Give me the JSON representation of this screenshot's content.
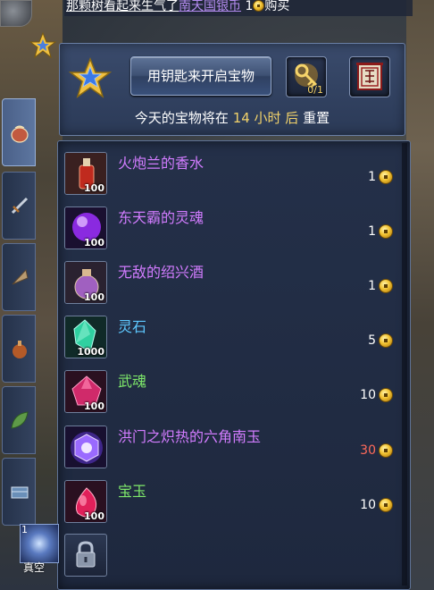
{
  "top_message": {
    "prefix": "那颗树看起来生气了",
    "link": "南天国银币",
    "count": "1",
    "suffix": "购买"
  },
  "panel": {
    "open_button_label": "用钥匙来开启宝物",
    "key_count": "0/1",
    "reset_prefix": "今天的宝物将在",
    "reset_hours": "14 小时 后",
    "reset_suffix": "重置"
  },
  "items": [
    {
      "name": "火炮兰的香水",
      "qty": "100",
      "price": "1",
      "name_color": "#d27cff",
      "price_color": "#ffffff",
      "icon": "perfume-bottle-icon"
    },
    {
      "name": "东天霸的灵魂",
      "qty": "100",
      "price": "1",
      "name_color": "#d27cff",
      "price_color": "#ffffff",
      "icon": "purple-orb-icon"
    },
    {
      "name": "无敌的绍兴酒",
      "qty": "100",
      "price": "1",
      "name_color": "#d27cff",
      "price_color": "#ffffff",
      "icon": "wine-jar-icon"
    },
    {
      "name": "灵石",
      "qty": "1000",
      "price": "5",
      "name_color": "#5ec8ff",
      "price_color": "#ffffff",
      "icon": "green-crystal-icon"
    },
    {
      "name": "武魂",
      "qty": "100",
      "price": "10",
      "name_color": "#7ee86a",
      "price_color": "#ffffff",
      "icon": "pink-gem-icon"
    },
    {
      "name": "洪门之炽热的六角南玉",
      "qty": "",
      "price": "30",
      "name_color": "#d27cff",
      "price_color": "#ff6a5a",
      "icon": "hexagon-jade-icon"
    },
    {
      "name": "宝玉",
      "qty": "100",
      "price": "10",
      "name_color": "#7ee86a",
      "price_color": "#ffffff",
      "icon": "pink-jewel-icon"
    }
  ],
  "side": {
    "skill_label": "真空",
    "skill_num": "1"
  }
}
